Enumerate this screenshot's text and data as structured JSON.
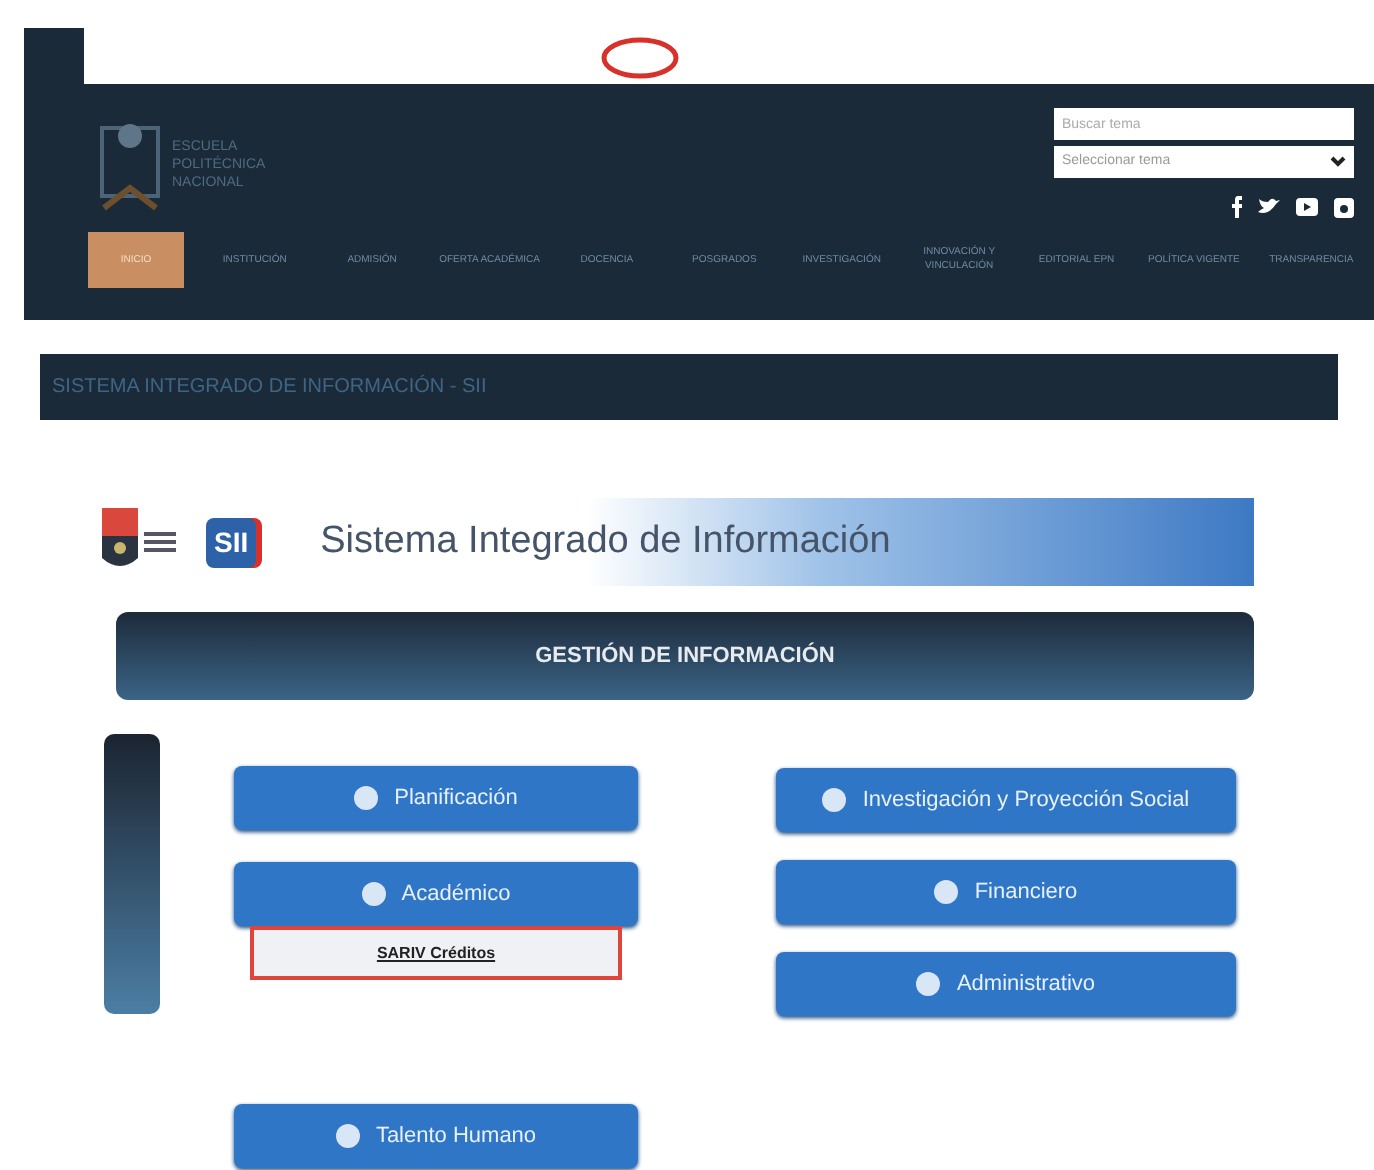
{
  "header": {
    "logo_text": [
      "ESCUELA",
      "POLITÉCNICA",
      "NACIONAL"
    ],
    "search": {
      "placeholder": "Buscar tema"
    },
    "select": {
      "value": "Seleccionar tema"
    }
  },
  "nav": [
    {
      "label": "INICIO",
      "selected": true
    },
    {
      "label": "INSTITUCIÓN",
      "selected": false
    },
    {
      "label": "ADMISIÓN",
      "selected": false
    },
    {
      "label": "OFERTA ACADÉMICA",
      "selected": false
    },
    {
      "label": "DOCENCIA",
      "selected": false
    },
    {
      "label": "POSGRADOS",
      "selected": false
    },
    {
      "label": "INVESTIGACIÓN",
      "selected": false
    },
    {
      "label": "INNOVACIÓN Y VINCULACIÓN",
      "selected": false
    },
    {
      "label": "EDITORIAL EPN",
      "selected": false
    },
    {
      "label": "POLÍTICA VIGENTE",
      "selected": false
    },
    {
      "label": "TRANSPARENCIA",
      "selected": false
    }
  ],
  "breadcrumb": "SISTEMA INTEGRADO DE INFORMACIÓN - SII",
  "banner": {
    "badge": "SII",
    "title": "Sistema Integrado de Información"
  },
  "section_title": "GESTIÓN DE INFORMACIÓN",
  "left_buttons": [
    {
      "label": "Planificación"
    },
    {
      "label": "Académico",
      "submenu": [
        "SARIV Créditos"
      ]
    },
    {
      "label": "Talento Humano"
    }
  ],
  "right_buttons": [
    {
      "label": "Investigación y Proyección Social"
    },
    {
      "label": "Financiero"
    },
    {
      "label": "Administrativo"
    }
  ]
}
